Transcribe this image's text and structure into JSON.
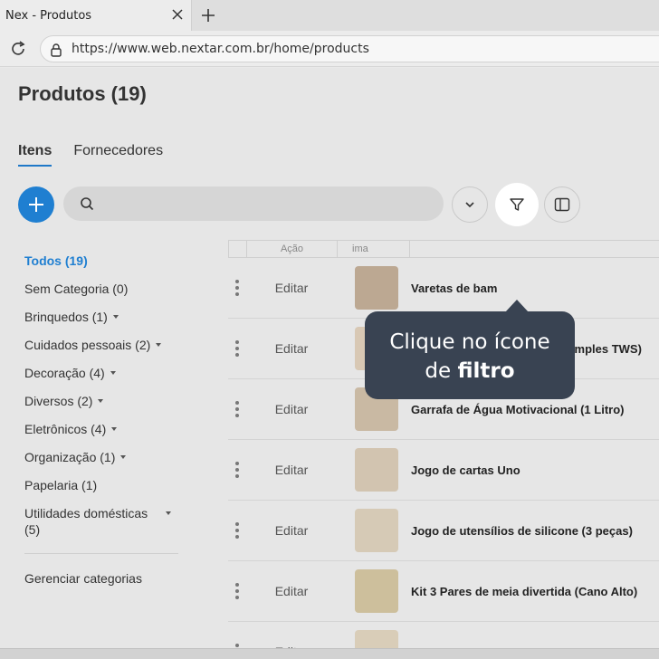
{
  "browser": {
    "tab_title": "Nex - Produtos",
    "url": "https://www.web.nextar.com.br/home/products"
  },
  "page": {
    "title": "Produtos (19)",
    "tabs": [
      "Itens",
      "Fornecedores"
    ],
    "active_tab": "Itens",
    "search_value": ""
  },
  "sidebar": {
    "categories": [
      {
        "label": "Todos (19)",
        "active": true,
        "has_caret": false
      },
      {
        "label": "Sem Categoria (0)",
        "has_caret": false
      },
      {
        "label": "Brinquedos (1)",
        "has_caret": true
      },
      {
        "label": "Cuidados pessoais (2)",
        "has_caret": true
      },
      {
        "label": "Decoração (4)",
        "has_caret": true
      },
      {
        "label": "Diversos (2)",
        "has_caret": true
      },
      {
        "label": "Eletrônicos (4)",
        "has_caret": true
      },
      {
        "label": "Organização (1)",
        "has_caret": true
      },
      {
        "label": "Papelaria (1)",
        "has_caret": false
      },
      {
        "label": "Utilidades domésticas (5)",
        "has_caret": true
      }
    ],
    "manage_label": "Gerenciar categorias"
  },
  "table": {
    "headers": [
      "Ação",
      "ima"
    ],
    "edit_label": "Editar",
    "rows": [
      {
        "name": "Varetas de bam",
        "thumb": "#bca892"
      },
      {
        "name": "Fone de ouvido Bluetooth (Simples TWS)",
        "thumb": "#d8c8b4"
      },
      {
        "name": "Garrafa de Água Motivacional (1 Litro)",
        "thumb": "#c9b9a3"
      },
      {
        "name": "Jogo de cartas Uno",
        "thumb": "#d2c4b0"
      },
      {
        "name": "Jogo de utensílios de silicone (3 peças)",
        "thumb": "#d6cab6"
      },
      {
        "name": "Kit 3 Pares de meia divertida (Cano Alto)",
        "thumb": "#cdbf9c"
      },
      {
        "name": "",
        "thumb": "#d9cdb8"
      }
    ]
  },
  "tooltip": {
    "line1": "Clique no ícone",
    "line2_prefix": "de ",
    "line2_bold": "filtro"
  }
}
